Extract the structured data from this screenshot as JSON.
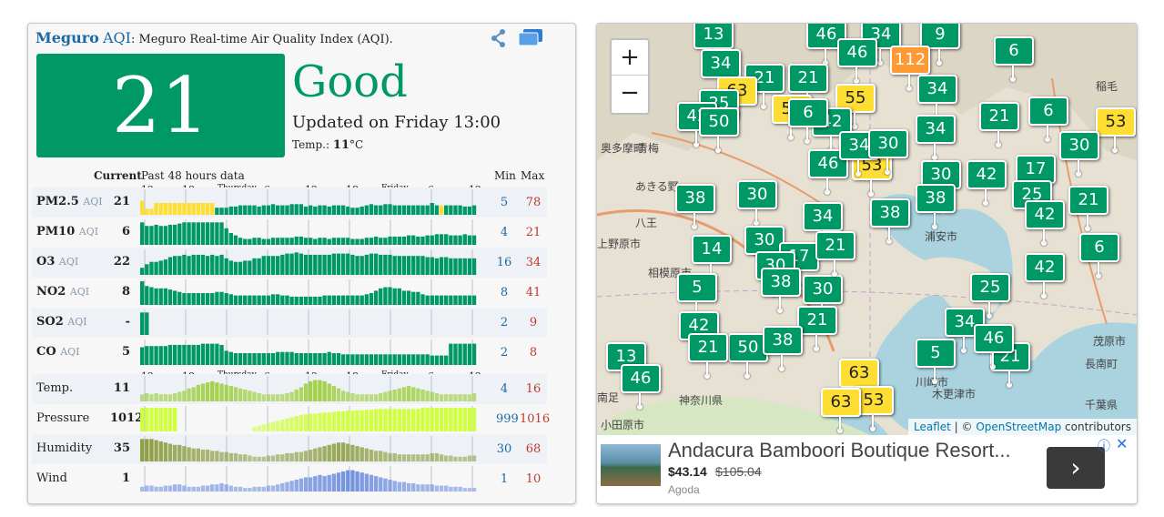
{
  "header": {
    "city": "Meguro",
    "aqi_word": "AQI",
    "subtitle": ": Meguro Real-time Air Quality Index (AQI)."
  },
  "summary": {
    "aqi": "21",
    "level": "Good",
    "updated": "Updated on Friday 13:00",
    "temp_label": "Temp.: ",
    "temp_value": "11",
    "temp_unit": "°C",
    "level_color": "#009966"
  },
  "table": {
    "current_label": "Current",
    "past_label": "Past 48 hours data",
    "min_label": "Min",
    "max_label": "Max",
    "time_ticks": [
      "12",
      "18",
      "Thursday",
      "6",
      "12",
      "18",
      "Friday",
      "6",
      "12"
    ],
    "rows": [
      {
        "name": "PM2.5",
        "unit": "AQI",
        "current": "21",
        "min": "5",
        "max": "78",
        "color": "#009966",
        "values": [
          60,
          25,
          25,
          50,
          50,
          50,
          50,
          50,
          50,
          50,
          50,
          50,
          50,
          50,
          50,
          50,
          30,
          30,
          30,
          35,
          35,
          40,
          40,
          40,
          40,
          35,
          40,
          40,
          45,
          40,
          40,
          40,
          45,
          45,
          45,
          35,
          40,
          35,
          40,
          40,
          35,
          40,
          40,
          40,
          35,
          30,
          30,
          35,
          40,
          45,
          40,
          40,
          45,
          45,
          40,
          40,
          40,
          40,
          40,
          40,
          40,
          40,
          50,
          40,
          40,
          40,
          40,
          40,
          40,
          35,
          35,
          40
        ]
      },
      {
        "name": "PM10",
        "unit": "AQI",
        "current": "6",
        "min": "4",
        "max": "21",
        "color": "#009966",
        "values": [
          95,
          80,
          80,
          85,
          80,
          80,
          85,
          85,
          90,
          95,
          95,
          95,
          95,
          95,
          95,
          95,
          95,
          95,
          70,
          50,
          40,
          30,
          25,
          25,
          30,
          30,
          25,
          25,
          30,
          30,
          30,
          30,
          30,
          35,
          35,
          30,
          30,
          25,
          30,
          30,
          25,
          30,
          30,
          30,
          30,
          25,
          25,
          25,
          30,
          30,
          35,
          30,
          30,
          35,
          35,
          35,
          35,
          40,
          40,
          35,
          35,
          40,
          40,
          45,
          45,
          45,
          40,
          40,
          40,
          45,
          40,
          40
        ]
      },
      {
        "name": "O3",
        "unit": "AQI",
        "current": "22",
        "min": "16",
        "max": "34",
        "color": "#009966",
        "values": [
          30,
          45,
          55,
          55,
          60,
          65,
          75,
          80,
          80,
          85,
          80,
          85,
          85,
          85,
          80,
          85,
          80,
          85,
          70,
          60,
          55,
          55,
          60,
          60,
          70,
          70,
          80,
          80,
          80,
          80,
          85,
          90,
          90,
          95,
          90,
          85,
          85,
          85,
          85,
          85,
          85,
          90,
          90,
          90,
          90,
          85,
          80,
          80,
          85,
          90,
          90,
          85,
          85,
          85,
          80,
          80,
          80,
          80,
          80,
          80,
          80,
          75,
          75,
          70,
          75,
          75,
          70,
          70,
          70,
          70,
          70,
          70
        ]
      },
      {
        "name": "NO2",
        "unit": "AQI",
        "current": "8",
        "min": "8",
        "max": "41",
        "color": "#009966",
        "values": [
          100,
          80,
          75,
          70,
          70,
          70,
          65,
          60,
          55,
          50,
          50,
          50,
          50,
          50,
          50,
          50,
          55,
          55,
          50,
          45,
          40,
          40,
          40,
          40,
          40,
          40,
          40,
          40,
          45,
          45,
          40,
          40,
          35,
          35,
          35,
          35,
          35,
          35,
          35,
          40,
          40,
          40,
          40,
          40,
          40,
          40,
          40,
          40,
          45,
          50,
          60,
          70,
          75,
          75,
          70,
          70,
          60,
          60,
          55,
          55,
          45,
          40,
          40,
          40,
          40,
          40,
          40,
          40,
          40,
          40,
          40,
          40
        ]
      },
      {
        "name": "SO2",
        "unit": "AQI",
        "current": "-",
        "min": "2",
        "max": "9",
        "color": "#009966",
        "values": [
          95,
          95
        ]
      },
      {
        "name": "CO",
        "unit": "AQI",
        "current": "5",
        "min": "2",
        "max": "8",
        "color": "#009966",
        "values": [
          75,
          80,
          80,
          80,
          80,
          80,
          85,
          85,
          85,
          85,
          85,
          85,
          85,
          90,
          90,
          90,
          90,
          85,
          60,
          55,
          50,
          50,
          50,
          50,
          50,
          50,
          50,
          50,
          50,
          55,
          55,
          55,
          55,
          50,
          50,
          50,
          50,
          50,
          50,
          50,
          55,
          50,
          50,
          45,
          45,
          45,
          45,
          45,
          45,
          45,
          45,
          45,
          45,
          45,
          45,
          45,
          45,
          45,
          45,
          45,
          45,
          45,
          40,
          40,
          40,
          40,
          90,
          90,
          90,
          90,
          90,
          90
        ]
      }
    ],
    "weather_rows": [
      {
        "name": "Temp.",
        "current": "11",
        "min": "4",
        "max": "16",
        "color": "#99cc33",
        "values": [
          30,
          35,
          30,
          35,
          30,
          30,
          30,
          35,
          40,
          45,
          55,
          60,
          70,
          75,
          80,
          85,
          80,
          75,
          70,
          65,
          60,
          55,
          50,
          45,
          40,
          35,
          30,
          30,
          30,
          30,
          30,
          35,
          40,
          50,
          60,
          75,
          85,
          90,
          90,
          85,
          75,
          65,
          55,
          45,
          40,
          35,
          30,
          30,
          30,
          30,
          30,
          35,
          40,
          45,
          50,
          55,
          60,
          65,
          60,
          55,
          50,
          45,
          40,
          35,
          30,
          30,
          30,
          30,
          30,
          30,
          30,
          35
        ]
      },
      {
        "name": "Pressure",
        "current": "1012",
        "min": "999",
        "max": "1016",
        "color": "#ccff33",
        "values": [
          100,
          100,
          100,
          100,
          100,
          100,
          100,
          100,
          0,
          0,
          0,
          0,
          0,
          0,
          0,
          0,
          0,
          0,
          0,
          0,
          0,
          0,
          0,
          0,
          20,
          25,
          30,
          35,
          40,
          45,
          50,
          55,
          60,
          65,
          70,
          72,
          75,
          75,
          78,
          80,
          80,
          82,
          85,
          85,
          88,
          88,
          90,
          90,
          92,
          92,
          95,
          95,
          95,
          95,
          95,
          95,
          95,
          95,
          95,
          95,
          100,
          100,
          100,
          100,
          100,
          100,
          100,
          100,
          100,
          100,
          100,
          100
        ]
      },
      {
        "name": "Humidity",
        "current": "35",
        "min": "30",
        "max": "68",
        "color": "#8a9a3a",
        "values": [
          95,
          95,
          95,
          90,
          85,
          80,
          75,
          70,
          70,
          65,
          60,
          55,
          55,
          50,
          50,
          45,
          45,
          40,
          40,
          35,
          35,
          30,
          30,
          25,
          20,
          20,
          20,
          25,
          25,
          30,
          30,
          35,
          35,
          40,
          40,
          45,
          50,
          55,
          60,
          65,
          70,
          75,
          80,
          80,
          75,
          70,
          65,
          60,
          55,
          50,
          45,
          45,
          40,
          35,
          35,
          30,
          30,
          30,
          30,
          30,
          30,
          30,
          35,
          35,
          30,
          25,
          25,
          20,
          20,
          20,
          25,
          25
        ]
      },
      {
        "name": "Wind",
        "current": "1",
        "min": "1",
        "max": "10",
        "color": "#6688dd",
        "values": [
          20,
          25,
          25,
          20,
          20,
          25,
          25,
          30,
          30,
          25,
          20,
          20,
          20,
          25,
          25,
          30,
          30,
          35,
          30,
          25,
          20,
          20,
          15,
          15,
          20,
          20,
          20,
          25,
          25,
          30,
          35,
          40,
          45,
          50,
          55,
          60,
          60,
          65,
          70,
          65,
          70,
          75,
          80,
          85,
          90,
          90,
          85,
          80,
          75,
          70,
          65,
          60,
          55,
          50,
          45,
          40,
          40,
          35,
          35,
          30,
          30,
          30,
          30,
          25,
          25,
          25,
          20,
          20,
          20,
          15,
          15,
          15
        ]
      }
    ],
    "pm25_highlights": [
      0,
      1,
      2,
      3,
      4,
      5,
      6,
      7,
      8,
      9,
      10,
      11,
      12,
      13,
      14,
      15,
      64
    ],
    "pm25_highlight_color": "#ffde33"
  },
  "map": {
    "zoom_in": "+",
    "zoom_out": "−",
    "attribution_leaflet": "Leaflet",
    "attribution_sep": " | © ",
    "attribution_osm": "OpenStreetMap",
    "attribution_tail": " contributors",
    "markers": [
      "13",
      "46",
      "34",
      "9",
      "6",
      "46",
      "112",
      "34",
      "21",
      "21",
      "63",
      "59",
      "55",
      "34",
      "25",
      "21",
      "6",
      "53",
      "42",
      "50",
      "42",
      "34",
      "30",
      "46",
      "53",
      "30",
      "42",
      "17",
      "38",
      "30",
      "34",
      "38",
      "25",
      "21",
      "42",
      "14",
      "30",
      "17",
      "38",
      "6",
      "30",
      "5",
      "38",
      "42",
      "25",
      "30",
      "21",
      "34",
      "42",
      "21",
      "50",
      "38",
      "5",
      "21",
      "13",
      "46",
      "63",
      "53",
      "63",
      "6",
      "34",
      "30",
      "21",
      "46"
    ],
    "labels": [
      "奥多摩町",
      "青梅",
      "あきる野",
      "八王",
      "上野原市",
      "相模原市",
      "浦安市",
      "神奈川県",
      "川崎市",
      "稲毛",
      "茂原市",
      "長南町",
      "千葉県",
      "小田原市",
      "木更津市",
      "南足"
    ]
  },
  "ad": {
    "title": "Andacura Bamboori Boutique Resort...",
    "price": "$43.14",
    "old_price": "$105.04",
    "source": "Agoda",
    "button": "›",
    "info": "ⓘ",
    "close": "✕"
  }
}
